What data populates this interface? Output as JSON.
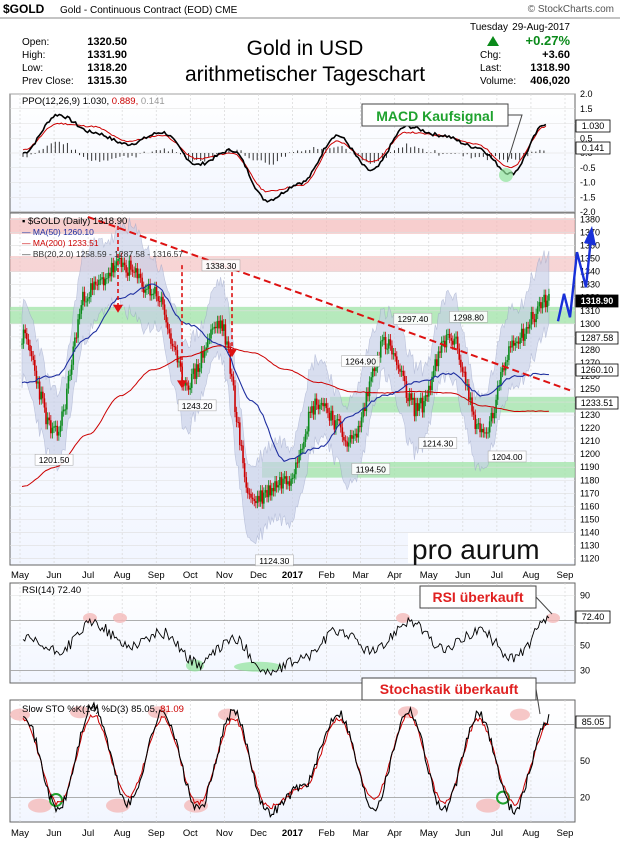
{
  "header": {
    "symbol": "$GOLD",
    "name": "Gold - Continuous Contract (EOD) CME",
    "watermark": "© StockCharts.com",
    "day": "Tuesday",
    "date": "29-Aug-2017",
    "title_line1": "Gold in USD",
    "title_line2": "arithmetischer Tageschart",
    "quote_left": [
      {
        "label": "Open:",
        "value": "1320.50"
      },
      {
        "label": "High:",
        "value": "1331.90"
      },
      {
        "label": "Low:",
        "value": "1318.20"
      },
      {
        "label": "Prev Close:",
        "value": "1315.30"
      }
    ],
    "quote_right": [
      {
        "label": "",
        "value": "+0.27%"
      },
      {
        "label": "Chg:",
        "value": "+3.60"
      },
      {
        "label": "Last:",
        "value": "1318.90"
      },
      {
        "label": "Volume:",
        "value": "406,020"
      }
    ]
  },
  "x_axis": [
    "May",
    "Jun",
    "Jul",
    "Aug",
    "Sep",
    "Oct",
    "Nov",
    "Dec",
    "2017",
    "Feb",
    "Mar",
    "Apr",
    "May",
    "Jun",
    "Jul",
    "Aug",
    "Sep"
  ],
  "chart_data": [
    {
      "panel": "ppo",
      "type": "line",
      "legend": {
        "label": "PPO(12,26,9)",
        "v1": "1.030",
        "v2": "0.889",
        "v3": "0.141"
      },
      "annotation": "MACD Kaufsignal",
      "ylim": [
        -2.0,
        2.0
      ],
      "yticks": [
        "2.0",
        "1.5",
        "1.0",
        "0.5",
        "0.0",
        "-0.5",
        "-1.0",
        "-1.5",
        "-2.0"
      ],
      "right_labels": [
        "1.030",
        "0.141"
      ],
      "months": [
        "May",
        "Jun",
        "Jul",
        "Aug",
        "Sep",
        "Oct",
        "Nov",
        "Dec",
        "Jan",
        "Feb",
        "Mar",
        "Apr",
        "May",
        "Jun",
        "Jul",
        "Aug"
      ],
      "series": [
        {
          "values": [
            0.0,
            1.3,
            0.7,
            0.3,
            0.7,
            -0.4,
            0.1,
            -1.6,
            -1.0,
            0.6,
            -0.6,
            0.9,
            0.6,
            0.2,
            -0.7,
            1.0
          ]
        },
        {
          "values": [
            0.1,
            1.0,
            0.9,
            0.4,
            0.6,
            -0.2,
            0.0,
            -1.3,
            -1.1,
            0.4,
            -0.3,
            0.7,
            0.6,
            0.3,
            -0.5,
            0.9
          ]
        }
      ]
    },
    {
      "panel": "price",
      "type": "line",
      "legend": {
        "symbol": "$GOLD (Daily)",
        "last": "1318.90",
        "ma50": "MA(50)",
        "ma50_val": "1260.10",
        "ma200": "MA(200)",
        "ma200_val": "1233.51",
        "bb": "BB(20,2.0)",
        "bb_vals": [
          "1258.59",
          "1287.58",
          "1316.57"
        ]
      },
      "annotation": "pro aurum",
      "ylim": [
        1115,
        1385
      ],
      "yticks": [
        "1380",
        "1370",
        "1360",
        "1350",
        "1340",
        "1330",
        "1320",
        "1310",
        "1300",
        "1290",
        "1280",
        "1270",
        "1260",
        "1250",
        "1240",
        "1230",
        "1220",
        "1210",
        "1200",
        "1190",
        "1180",
        "1170",
        "1160",
        "1150",
        "1140",
        "1130",
        "1120"
      ],
      "right_labels": [
        "1318.90",
        "1287.58",
        "1260.10",
        "1233.51"
      ],
      "peak_labels": [
        {
          "text": "1338.30",
          "x": "2016-10-28",
          "y": 1338.3
        },
        {
          "text": "1297.40",
          "x": "2017-04-17",
          "y": 1297.4
        },
        {
          "text": "1298.80",
          "x": "2017-06-06",
          "y": 1298.8
        },
        {
          "text": "1264.90",
          "x": "2017-03-01",
          "y": 1264.9
        },
        {
          "text": "1243.20",
          "x": "2016-10-07",
          "y": 1243.2
        },
        {
          "text": "1201.50",
          "x": "2016-05-31",
          "y": 1201.5
        },
        {
          "text": "1194.50",
          "x": "2017-03-10",
          "y": 1194.5
        },
        {
          "text": "1214.30",
          "x": "2017-05-09",
          "y": 1214.3
        },
        {
          "text": "1204.00",
          "x": "2017-07-10",
          "y": 1204.0
        },
        {
          "text": "1124.30",
          "x": "2016-12-15",
          "y": 1124.3
        }
      ],
      "months": [
        "May",
        "Jun",
        "Jul",
        "Aug",
        "Sep",
        "Oct",
        "Nov",
        "Dec",
        "Jan",
        "Feb",
        "Mar",
        "Apr",
        "May",
        "Jun",
        "Jul",
        "Aug",
        "Sep"
      ],
      "series": [
        {
          "values": [
            1290,
            1215,
            1325,
            1345,
            1325,
            1255,
            1300,
            1165,
            1180,
            1240,
            1210,
            1285,
            1235,
            1290,
            1215,
            1290,
            1319
          ]
        },
        {
          "values": [
            1255,
            1260,
            1290,
            1320,
            1330,
            1300,
            1285,
            1240,
            1195,
            1205,
            1230,
            1245,
            1255,
            1262,
            1245,
            1260,
            1262
          ]
        },
        {
          "values": [
            1175,
            1190,
            1215,
            1245,
            1265,
            1275,
            1283,
            1278,
            1265,
            1255,
            1248,
            1247,
            1248,
            1247,
            1237,
            1233,
            1233
          ]
        }
      ]
    },
    {
      "panel": "rsi",
      "type": "line",
      "legend": {
        "label": "RSI(14)",
        "value": "72.40"
      },
      "annotation": "RSI überkauft",
      "ylim": [
        20,
        100
      ],
      "yticks": [
        "90",
        "70",
        "50",
        "30"
      ],
      "right_labels": [
        "72.40"
      ],
      "months": [
        "May",
        "Jun",
        "Jul",
        "Aug",
        "Sep",
        "Oct",
        "Nov",
        "Dec",
        "Jan",
        "Feb",
        "Mar",
        "Apr",
        "May",
        "Jun",
        "Jul",
        "Aug"
      ],
      "series": [
        {
          "values": [
            55,
            45,
            68,
            50,
            60,
            35,
            55,
            28,
            40,
            62,
            45,
            70,
            47,
            62,
            40,
            70
          ]
        }
      ]
    },
    {
      "panel": "sto",
      "type": "line",
      "legend": {
        "label": "Slow STO %K(14) %D(3)",
        "k": "85.05",
        "d": "81.09"
      },
      "annotation": "Stochastik überkauft",
      "ylim": [
        0,
        100
      ],
      "yticks": [
        "80",
        "50",
        "20"
      ],
      "right_labels": [
        "85.05"
      ],
      "months": [
        "May",
        "Jun",
        "Jul",
        "Aug",
        "Sep",
        "Oct",
        "Nov",
        "Dec",
        "Jan",
        "Feb",
        "Mar",
        "Apr",
        "May",
        "Jun",
        "Jul",
        "Aug"
      ],
      "series": [
        {
          "values": [
            90,
            10,
            95,
            15,
            90,
            10,
            90,
            8,
            30,
            90,
            12,
            92,
            10,
            88,
            10,
            85
          ]
        },
        {
          "values": [
            85,
            15,
            88,
            20,
            85,
            15,
            85,
            12,
            28,
            85,
            18,
            88,
            15,
            84,
            15,
            81
          ]
        }
      ]
    }
  ],
  "colors": {
    "ppo_line": "#000000",
    "signal": "#cc0000",
    "histogram": "#000000",
    "ma50": "#1f2fa0",
    "ma200": "#cc0000",
    "bb_fill": "#c7cfe8",
    "green_zone": "#9fe3a6",
    "red_zone": "#f4b9b9",
    "annotation_green": "#1fa22e",
    "annotation_red": "#e02020"
  }
}
